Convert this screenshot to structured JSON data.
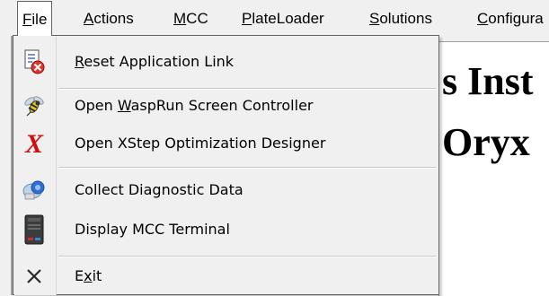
{
  "menubar": {
    "items": [
      {
        "label": "File",
        "mnemonic": "F",
        "rest": "ile"
      },
      {
        "label": "Actions",
        "mnemonic": "A",
        "rest": "ctions"
      },
      {
        "label": "MCC",
        "mnemonic": "M",
        "rest": "CC"
      },
      {
        "label": "PlateLoader",
        "mnemonic": "P",
        "rest": "lateLoader"
      },
      {
        "label": "Solutions",
        "mnemonic": "S",
        "rest": "olutions"
      },
      {
        "label": "Configura",
        "mnemonic": "C",
        "rest": "onfigura"
      }
    ]
  },
  "background": {
    "heading_line1": "s Inst",
    "heading_line2": "Oryx"
  },
  "file_menu": {
    "items": [
      {
        "id": "reset-application-link",
        "pre": "",
        "mnemonic": "R",
        "post": "eset Application Link",
        "icon": "reset-link-icon"
      },
      {
        "id": "open-wasprun",
        "pre": "Open ",
        "mnemonic": "W",
        "post": "aspRun Screen Controller",
        "icon": "wasprun-icon"
      },
      {
        "id": "open-xstep",
        "pre": "Open XStep Optimization Designer",
        "mnemonic": "",
        "post": "",
        "icon": "xstep-icon"
      },
      {
        "id": "collect-diagnostic",
        "pre": "Collect Diagnostic Data",
        "mnemonic": "",
        "post": "",
        "icon": "diagnostic-icon"
      },
      {
        "id": "display-mcc-terminal",
        "pre": "Display MCC Terminal",
        "mnemonic": "",
        "post": "",
        "icon": "terminal-icon"
      },
      {
        "id": "exit",
        "pre": "E",
        "mnemonic": "x",
        "post": "it",
        "icon": "exit-icon"
      }
    ]
  },
  "colors": {
    "menu_bg": "#f0f0f0",
    "xstep_red": "#d01010",
    "highlight_border": "#646464"
  }
}
